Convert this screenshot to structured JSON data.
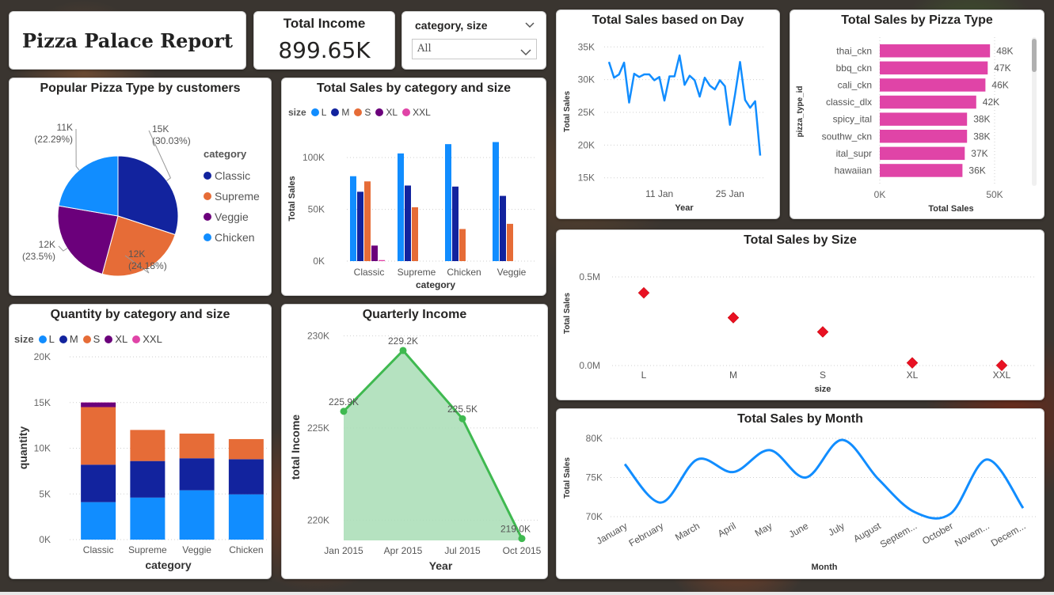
{
  "report_title": "Pizza Palace Report",
  "kpi": {
    "label": "Total Income",
    "value": "899.65K"
  },
  "slicer": {
    "label": "category, size",
    "selected": "All"
  },
  "colors": {
    "L": "#118DFF",
    "M": "#12239E",
    "S": "#E66C37",
    "XL": "#6B007B",
    "XXL": "#E044A7",
    "Classic": "#12239E",
    "Supreme": "#E66C37",
    "Veggie": "#6B007B",
    "Chicken": "#118DFF",
    "line": "#118DFF",
    "pink_bar": "#E044A7",
    "quarter_line": "#3FB950",
    "quarter_fill": "#A8DDB5",
    "diamond": "#E81123"
  },
  "chart_data": [
    {
      "id": "pie",
      "type": "pie",
      "title": "Popular Pizza Type by customers",
      "legend_title": "category",
      "slices": [
        {
          "name": "Classic",
          "value": 15000,
          "label": "15K",
          "pct": "(30.03%)",
          "frac": 0.3003
        },
        {
          "name": "Supreme",
          "value": 12000,
          "label": "12K",
          "pct": "(24.18%)",
          "frac": 0.2418
        },
        {
          "name": "Veggie",
          "value": 12000,
          "label": "12K",
          "pct": "(23.5%)",
          "frac": 0.235
        },
        {
          "name": "Chicken",
          "value": 11000,
          "label": "11K",
          "pct": "(22.29%)",
          "frac": 0.2229
        }
      ],
      "legend_placement": "right"
    },
    {
      "id": "clustered",
      "type": "bar",
      "title": "Total Sales by category and size",
      "legend_title": "size",
      "legend": [
        "L",
        "M",
        "S",
        "XL",
        "XXL"
      ],
      "categories": [
        "Classic",
        "Supreme",
        "Chicken",
        "Veggie"
      ],
      "xlabel": "category",
      "ylabel": "Total Sales",
      "yticks": [
        "0K",
        "50K",
        "100K"
      ],
      "ylim": [
        0,
        120000
      ],
      "series": [
        {
          "name": "L",
          "values": [
            82000,
            104000,
            113000,
            115000
          ]
        },
        {
          "name": "M",
          "values": [
            67000,
            73000,
            72000,
            63000
          ]
        },
        {
          "name": "S",
          "values": [
            77000,
            52000,
            31000,
            36000
          ]
        },
        {
          "name": "XL",
          "values": [
            15000,
            0,
            0,
            0
          ]
        },
        {
          "name": "XXL",
          "values": [
            1000,
            0,
            0,
            0
          ]
        }
      ]
    },
    {
      "id": "stacked",
      "type": "bar",
      "title": "Quantity by category and size",
      "legend_title": "size",
      "legend": [
        "L",
        "M",
        "S",
        "XL",
        "XXL"
      ],
      "categories": [
        "Classic",
        "Supreme",
        "Veggie",
        "Chicken"
      ],
      "xlabel": "category",
      "ylabel": "quantity",
      "yticks": [
        "0K",
        "5K",
        "10K",
        "15K",
        "20K"
      ],
      "ylim": [
        0,
        20000
      ],
      "series": [
        {
          "name": "L",
          "values": [
            4100,
            4600,
            5400,
            4950
          ]
        },
        {
          "name": "M",
          "values": [
            4100,
            4000,
            3500,
            3850
          ]
        },
        {
          "name": "S",
          "values": [
            6300,
            3400,
            2700,
            2200
          ]
        },
        {
          "name": "XL",
          "values": [
            500,
            0,
            0,
            0
          ]
        },
        {
          "name": "XXL",
          "values": [
            30,
            0,
            0,
            0
          ]
        }
      ]
    },
    {
      "id": "quarterly",
      "type": "area",
      "title": "Quarterly Income",
      "categories": [
        "Jan 2015",
        "Apr 2015",
        "Jul 2015",
        "Oct 2015"
      ],
      "values": [
        225.9,
        229.2,
        225.5,
        219.0
      ],
      "data_labels": [
        "225.9K",
        "229.2K",
        "225.5K",
        "219.0K"
      ],
      "yticks": [
        "220K",
        "225K",
        "230K"
      ],
      "ylim": [
        218.9,
        230.4
      ],
      "xlabel": "Year",
      "ylabel": "total Income"
    },
    {
      "id": "daily",
      "type": "line",
      "title": "Total Sales based on Day",
      "xticks": [
        "11 Jan",
        "25 Jan"
      ],
      "yticks": [
        "15K",
        "20K",
        "25K",
        "30K",
        "35K"
      ],
      "ylim": [
        14000,
        36000
      ],
      "xlabel": "Year",
      "ylabel": "Total Sales",
      "values": [
        32700,
        30300,
        30800,
        32600,
        26500,
        30900,
        30400,
        30800,
        30800,
        29900,
        30400,
        26800,
        30500,
        30500,
        33700,
        29200,
        30600,
        29900,
        27400,
        30300,
        29100,
        28500,
        29900,
        29000,
        23100,
        27700,
        32700,
        26900,
        25700,
        26700,
        18400
      ]
    },
    {
      "id": "pizza_type",
      "type": "bar",
      "title": "Total Sales by Pizza Type",
      "orientation": "horizontal",
      "categories": [
        "thai_ckn",
        "bbq_ckn",
        "cali_ckn",
        "classic_dlx",
        "spicy_ital",
        "southw_ckn",
        "ital_supr",
        "hawaiian"
      ],
      "values": [
        48000,
        47000,
        46000,
        42000,
        38000,
        38000,
        37000,
        36000
      ],
      "data_labels": [
        "48K",
        "47K",
        "46K",
        "42K",
        "38K",
        "38K",
        "37K",
        "36K"
      ],
      "xticks": [
        "0K",
        "50K"
      ],
      "xlim": [
        0,
        50000
      ],
      "xlabel": "Total Sales",
      "ylabel": "pizza_type_id"
    },
    {
      "id": "by_size",
      "type": "scatter",
      "title": "Total Sales by Size",
      "categories": [
        "L",
        "M",
        "S",
        "XL",
        "XXL"
      ],
      "values": [
        0.41,
        0.27,
        0.19,
        0.015,
        0.001
      ],
      "yticks": [
        "0.0M",
        "0.5M"
      ],
      "ylim": [
        0,
        0.5
      ],
      "xlabel": "size",
      "ylabel": "Total Sales"
    },
    {
      "id": "monthly",
      "type": "line",
      "title": "Total Sales by Month",
      "categories": [
        "January",
        "February",
        "March",
        "April",
        "May",
        "June",
        "July",
        "August",
        "Septem...",
        "October",
        "Novem...",
        "Decem..."
      ],
      "values": [
        76700,
        71800,
        77300,
        75700,
        78500,
        75000,
        79800,
        74800,
        70600,
        70400,
        77300,
        71100
      ],
      "yticks": [
        "70K",
        "75K",
        "80K"
      ],
      "ylim": [
        69500,
        81000
      ],
      "xlabel": "Month",
      "ylabel": "Total Sales"
    }
  ]
}
